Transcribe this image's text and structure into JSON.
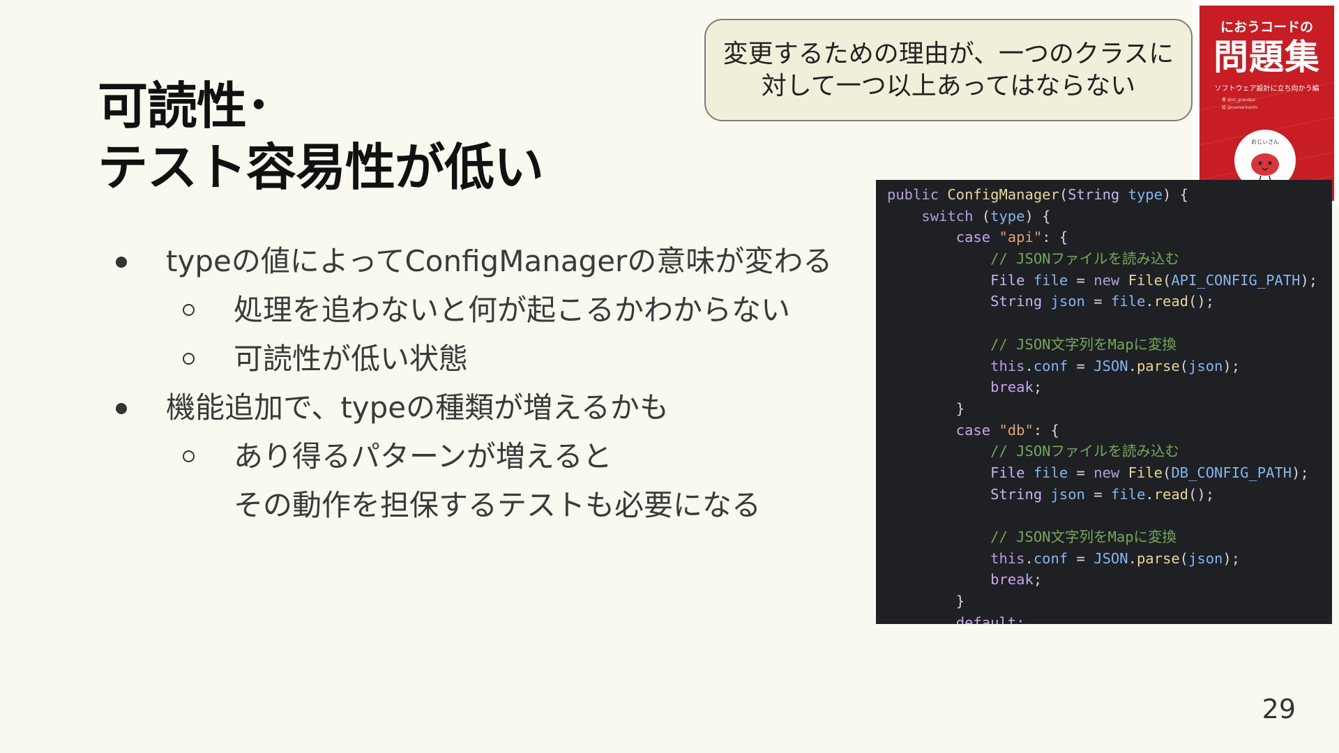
{
  "title": {
    "line1": "可読性･",
    "line2": "テスト容易性が低い"
  },
  "bullets": [
    {
      "text": "typeの値によってConfigManagerの意味が変わる",
      "children": [
        "処理を追わないと何が起こるかわからない",
        "可読性が低い状態"
      ]
    },
    {
      "text": "機能追加で、typeの種類が増えるかも",
      "children": [
        "あり得るパターンが増えると",
        "その動作を担保するテストも必要になる"
      ]
    }
  ],
  "callout": {
    "line1": "変更するための理由が、一つのクラスに",
    "line2": "対して一つ以上あってはならない"
  },
  "book": {
    "subtitle_top": "におうコードの",
    "title": "問題集",
    "tagline": "ソフトウェア設計に立ち向かう編",
    "author1": "著 @ot_grandpa",
    "author2": "絵 @namerinochi",
    "mascot_text": "おじぃさん",
    "color": "#c81d24"
  },
  "code": {
    "lines": [
      [
        [
          "kw",
          "public "
        ],
        [
          "ty",
          "ConfigManager"
        ],
        [
          "p",
          "("
        ],
        [
          "ty2",
          "String"
        ],
        [
          "p",
          " "
        ],
        [
          "va",
          "type"
        ],
        [
          "p",
          ") {"
        ]
      ],
      [
        [
          "p",
          "    "
        ],
        [
          "kw",
          "switch"
        ],
        [
          "p",
          " ("
        ],
        [
          "va",
          "type"
        ],
        [
          "p",
          ") {"
        ]
      ],
      [
        [
          "p",
          "        "
        ],
        [
          "cs",
          "case "
        ],
        [
          "st",
          "\"api\""
        ],
        [
          "p",
          ": {"
        ]
      ],
      [
        [
          "p",
          "            "
        ],
        [
          "cm",
          "// JSONファイルを読み込む"
        ]
      ],
      [
        [
          "p",
          "            "
        ],
        [
          "ty2",
          "File "
        ],
        [
          "va",
          "file"
        ],
        [
          "p",
          " = "
        ],
        [
          "kw",
          "new "
        ],
        [
          "ty",
          "File"
        ],
        [
          "p",
          "("
        ],
        [
          "va",
          "API_CONFIG_PATH"
        ],
        [
          "p",
          ");"
        ]
      ],
      [
        [
          "p",
          "            "
        ],
        [
          "ty2",
          "String "
        ],
        [
          "va",
          "json"
        ],
        [
          "p",
          " = "
        ],
        [
          "va",
          "file"
        ],
        [
          "p",
          "."
        ],
        [
          "fn",
          "read"
        ],
        [
          "p",
          "();"
        ]
      ],
      [
        [
          "p",
          ""
        ]
      ],
      [
        [
          "p",
          "            "
        ],
        [
          "cm",
          "// JSON文字列をMapに変換"
        ]
      ],
      [
        [
          "p",
          "            "
        ],
        [
          "kw",
          "this"
        ],
        [
          "p",
          "."
        ],
        [
          "va",
          "conf"
        ],
        [
          "p",
          " = "
        ],
        [
          "va",
          "JSON"
        ],
        [
          "p",
          "."
        ],
        [
          "fn",
          "parse"
        ],
        [
          "p",
          "("
        ],
        [
          "va",
          "json"
        ],
        [
          "p",
          ");"
        ]
      ],
      [
        [
          "p",
          "            "
        ],
        [
          "cs",
          "break"
        ],
        [
          "p",
          ";"
        ]
      ],
      [
        [
          "p",
          "        }"
        ]
      ],
      [
        [
          "p",
          "        "
        ],
        [
          "cs",
          "case "
        ],
        [
          "st",
          "\"db\""
        ],
        [
          "p",
          ": {"
        ]
      ],
      [
        [
          "p",
          "            "
        ],
        [
          "cm",
          "// JSONファイルを読み込む"
        ]
      ],
      [
        [
          "p",
          "            "
        ],
        [
          "ty2",
          "File "
        ],
        [
          "va",
          "file"
        ],
        [
          "p",
          " = "
        ],
        [
          "kw",
          "new "
        ],
        [
          "ty",
          "File"
        ],
        [
          "p",
          "("
        ],
        [
          "va",
          "DB_CONFIG_PATH"
        ],
        [
          "p",
          ");"
        ]
      ],
      [
        [
          "p",
          "            "
        ],
        [
          "ty2",
          "String "
        ],
        [
          "va",
          "json"
        ],
        [
          "p",
          " = "
        ],
        [
          "va",
          "file"
        ],
        [
          "p",
          "."
        ],
        [
          "fn",
          "read"
        ],
        [
          "p",
          "();"
        ]
      ],
      [
        [
          "p",
          ""
        ]
      ],
      [
        [
          "p",
          "            "
        ],
        [
          "cm",
          "// JSON文字列をMapに変換"
        ]
      ],
      [
        [
          "p",
          "            "
        ],
        [
          "kw",
          "this"
        ],
        [
          "p",
          "."
        ],
        [
          "va",
          "conf"
        ],
        [
          "p",
          " = "
        ],
        [
          "va",
          "JSON"
        ],
        [
          "p",
          "."
        ],
        [
          "fn",
          "parse"
        ],
        [
          "p",
          "("
        ],
        [
          "va",
          "json"
        ],
        [
          "p",
          ");"
        ]
      ],
      [
        [
          "p",
          "            "
        ],
        [
          "cs",
          "break"
        ],
        [
          "p",
          ";"
        ]
      ],
      [
        [
          "p",
          "        }"
        ]
      ],
      [
        [
          "p",
          "        "
        ],
        [
          "cs",
          "default:"
        ]
      ]
    ]
  },
  "page_number": "29"
}
